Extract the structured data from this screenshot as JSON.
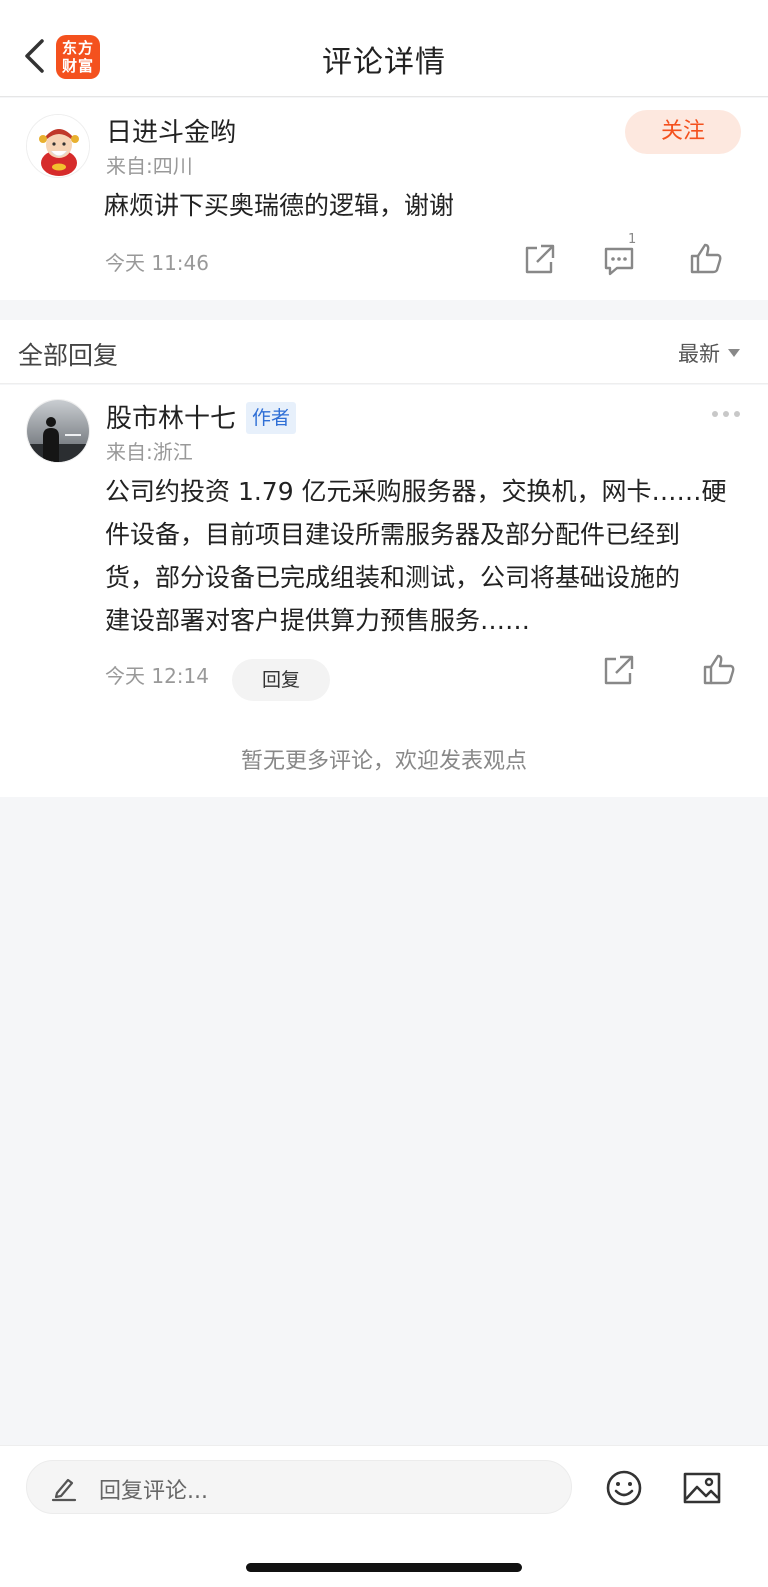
{
  "header": {
    "title": "评论详情",
    "logo_line1": "东方",
    "logo_line2": "财富",
    "brand_color": "#f4511e"
  },
  "main_comment": {
    "username": "日进斗金哟",
    "location": "来自:四川",
    "follow_label": "关注",
    "text": "麻烦讲下买奥瑞德的逻辑，谢谢",
    "time": "今天 11:46",
    "comment_count": "1"
  },
  "replies_section": {
    "title": "全部回复",
    "sort_label": "最新"
  },
  "reply": {
    "username": "股市林十七",
    "author_badge": "作者",
    "location": "来自:浙江",
    "text_lines": [
      "公司约投资 1.79 亿元采购服务器，交换机，网卡……硬",
      "件设备，目前项目建设所需服务器及部分配件已经到",
      "货，部分设备已完成组装和测试，公司将基础设施的",
      "建设部署对客户提供算力预售服务……"
    ],
    "time": "今天 12:14",
    "reply_label": "回复"
  },
  "no_more_text": "暂无更多评论，欢迎发表观点",
  "bottom_bar": {
    "input_placeholder": "回复评论..."
  }
}
